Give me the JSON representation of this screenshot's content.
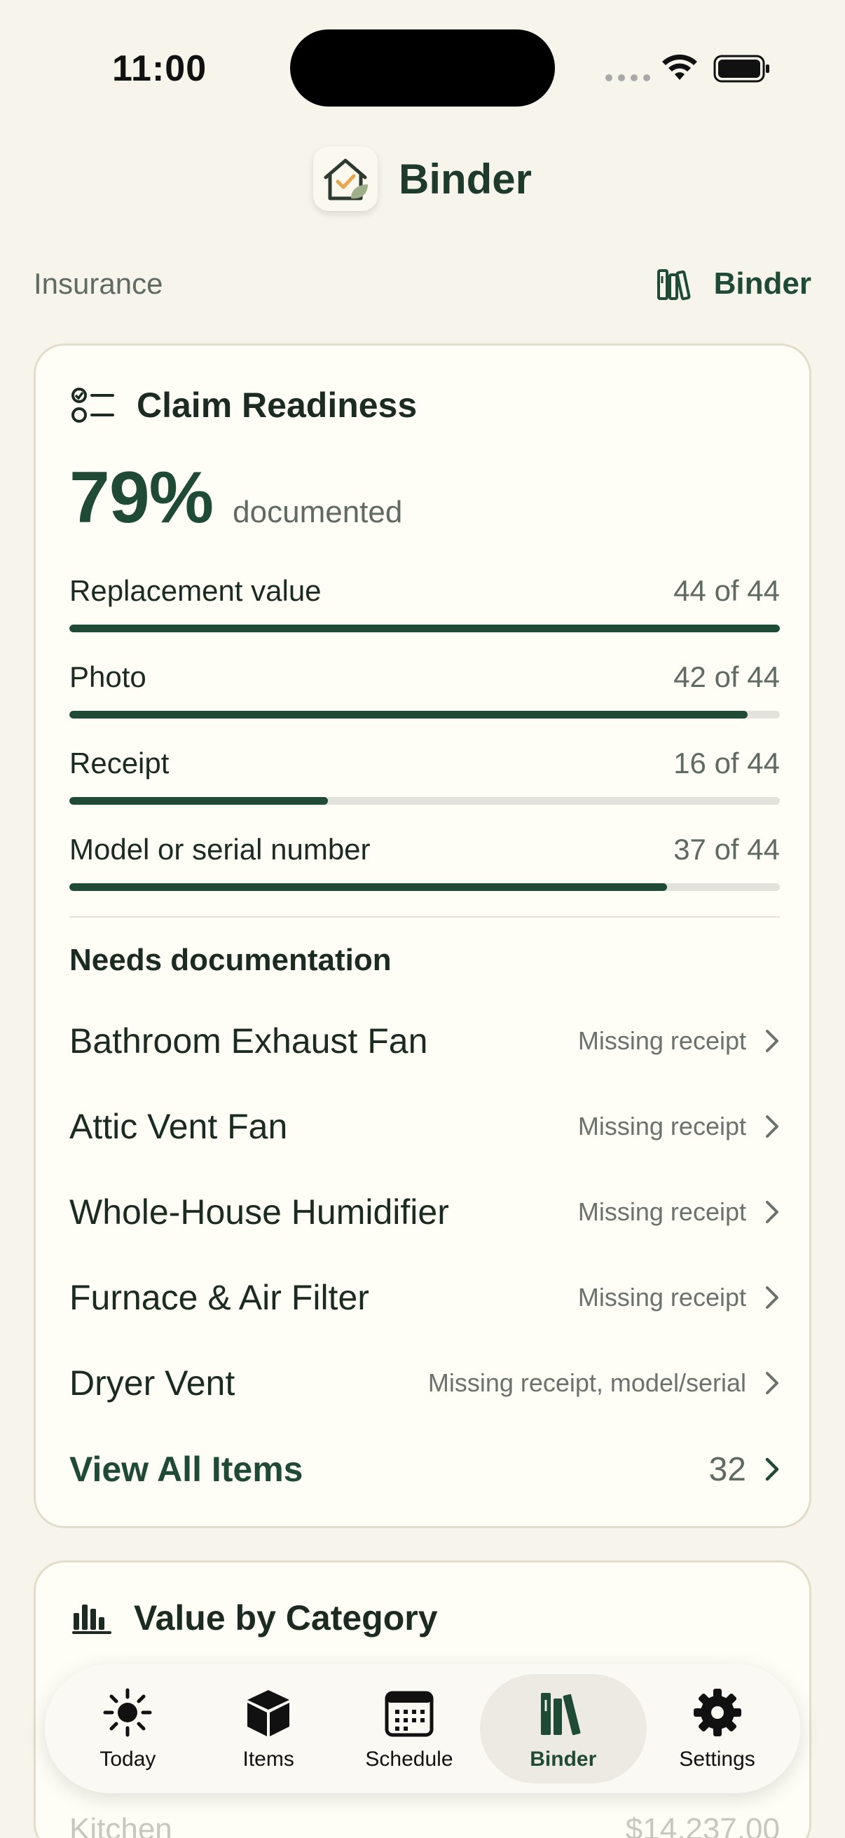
{
  "status": {
    "time": "11:00"
  },
  "header": {
    "title": "Binder"
  },
  "section": {
    "label": "Insurance",
    "link_label": "Binder"
  },
  "claim": {
    "title": "Claim Readiness",
    "percent": "79%",
    "percent_suffix": "documented",
    "metrics": [
      {
        "label": "Replacement value",
        "count": "44 of 44",
        "fraction": 1.0
      },
      {
        "label": "Photo",
        "count": "42 of 44",
        "fraction": 0.9545
      },
      {
        "label": "Receipt",
        "count": "16 of 44",
        "fraction": 0.3636
      },
      {
        "label": "Model or serial number",
        "count": "37 of 44",
        "fraction": 0.8409
      }
    ],
    "needs_title": "Needs documentation",
    "items": [
      {
        "name": "Bathroom Exhaust Fan",
        "note": "Missing receipt"
      },
      {
        "name": "Attic Vent Fan",
        "note": "Missing receipt"
      },
      {
        "name": "Whole-House Humidifier",
        "note": "Missing receipt"
      },
      {
        "name": "Furnace & Air Filter",
        "note": "Missing receipt"
      },
      {
        "name": "Dryer Vent",
        "note": "Missing receipt, model/serial"
      }
    ],
    "view_all_label": "View All Items",
    "view_all_count": "32"
  },
  "category": {
    "title": "Value by Category",
    "rows": [
      {
        "name": "Kitchen",
        "value": "$14,237.00"
      }
    ]
  },
  "tabs": [
    {
      "label": "Today",
      "icon": "sun-icon"
    },
    {
      "label": "Items",
      "icon": "box-icon"
    },
    {
      "label": "Schedule",
      "icon": "calendar-icon"
    },
    {
      "label": "Binder",
      "icon": "books-icon"
    },
    {
      "label": "Settings",
      "icon": "gear-icon"
    }
  ],
  "colors": {
    "accent": "#1f4a35",
    "background": "#f7f4ec",
    "card": "#fefdf6"
  }
}
